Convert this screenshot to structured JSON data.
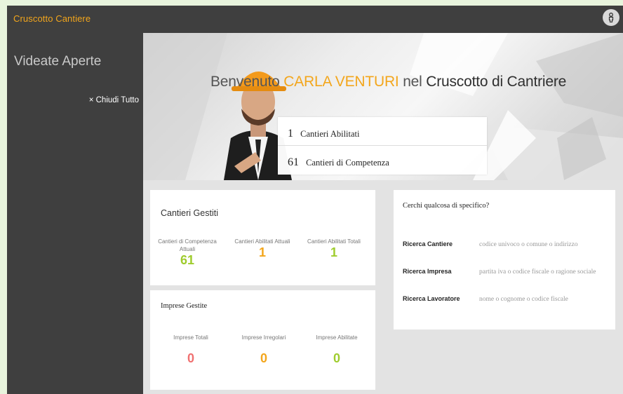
{
  "app": {
    "title": "Cruscotto Cantiere"
  },
  "sidebar": {
    "title": "Videate Aperte",
    "close_all": "× Chiudi Tutto"
  },
  "hero": {
    "welcome_prefix": "Benvenuto",
    "user_name": "CARLA VENTURI",
    "welcome_mid": "nel",
    "brand": "Cruscotto di Cantriere",
    "stats": [
      {
        "value": "1",
        "label": "Cantieri Abilitati"
      },
      {
        "value": "61",
        "label": "Cantieri di Competenza"
      }
    ]
  },
  "cantieri_card": {
    "title": "Cantieri Gestiti",
    "metrics": [
      {
        "label": "Cantieri di Competenza Attuali",
        "value": "61",
        "color": "#9fcc2e"
      },
      {
        "label": "Cantieri Abilitati Attuali",
        "value": "1",
        "color": "#f3a61c"
      },
      {
        "label": "Cantieri Abilitati Totali",
        "value": "1",
        "color": "#9fcc2e"
      }
    ]
  },
  "imprese_card": {
    "title": "Imprese Gestite",
    "metrics": [
      {
        "label": "Imprese Totali",
        "value": "0",
        "color": "#f07070"
      },
      {
        "label": "Imprese Irregolari",
        "value": "0",
        "color": "#f3a61c"
      },
      {
        "label": "Imprese Abilitate",
        "value": "0",
        "color": "#9fcc2e"
      }
    ]
  },
  "search": {
    "question": "Cerchi qualcosa di specifico?",
    "rows": [
      {
        "label": "Ricerca Cantiere",
        "placeholder": "codice univoco o comune o indirizzo"
      },
      {
        "label": "Ricerca Impresa",
        "placeholder": "partita iva o codice fiscale o ragione sociale"
      },
      {
        "label": "Ricerca Lavoratore",
        "placeholder": "nome o cognome o codice fiscale"
      }
    ]
  },
  "icons": {
    "user": "user-icon"
  }
}
